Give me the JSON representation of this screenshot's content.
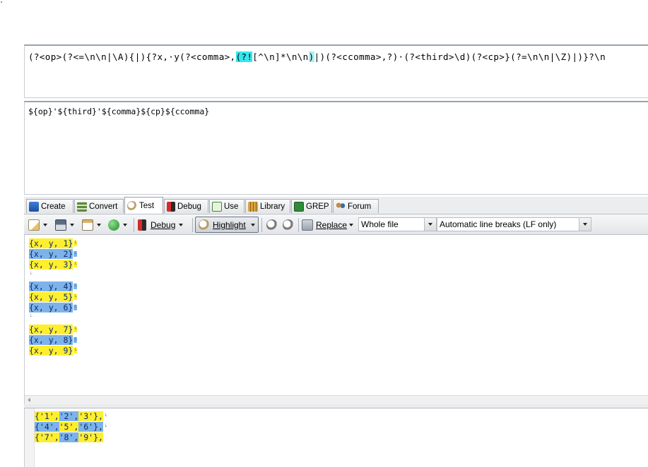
{
  "regex": {
    "seg1": "(?<op>(?<=\\n\\n|\\A){|){?x,·y(?<comma>,",
    "seg2": "(?!",
    "seg3": "[^\\n]*\\n\\n",
    "seg4": ")",
    "seg5": "|)(?<ccomma>,?)·(?<third>\\d)(?<cp>}(?=\\n\\n|\\Z)|)}?\\n"
  },
  "replacement": "${op}'${third}'${comma}${cp}${ccomma}",
  "tabs": [
    {
      "label": "Create",
      "icon": "create-icon"
    },
    {
      "label": "Convert",
      "icon": "convert-icon"
    },
    {
      "label": "Test",
      "icon": "magnifier-icon"
    },
    {
      "label": "Debug",
      "icon": "bug-icon"
    },
    {
      "label": "Use",
      "icon": "use-icon"
    },
    {
      "label": "Library",
      "icon": "library-icon"
    },
    {
      "label": "GREP",
      "icon": "grep-icon"
    },
    {
      "label": "Forum",
      "icon": "forum-icon"
    }
  ],
  "toolbar": {
    "debug_label": "Debug",
    "highlight_label": "Highlight",
    "replace_label": "Replace",
    "scope_value": "Whole file",
    "linebreak_value": "Automatic line breaks (LF only)"
  },
  "test_lines": [
    {
      "text": "{x, y, 1}",
      "color": "#ffee2e"
    },
    {
      "text": "{x, y, 2}",
      "color": "#7db3ea"
    },
    {
      "text": "{x, y, 3}",
      "color": "#ffee2e"
    },
    {
      "text": "",
      "color": ""
    },
    {
      "text": "{x, y, 4}",
      "color": "#7db3ea"
    },
    {
      "text": "{x, y, 5}",
      "color": "#ffee2e"
    },
    {
      "text": "{x, y, 6}",
      "color": "#7db3ea"
    },
    {
      "text": "",
      "color": ""
    },
    {
      "text": "{x, y, 7}",
      "color": "#ffee2e"
    },
    {
      "text": "{x, y, 8}",
      "color": "#7db3ea"
    },
    {
      "text": "{x, y, 9}",
      "color": "#ffee2e"
    }
  ],
  "output_lines": [
    [
      {
        "text": "{'1',",
        "color": "#ffee2e"
      },
      {
        "text": "'2',",
        "color": "#7db3ea"
      },
      {
        "text": "'3'},",
        "color": "#ffee2e"
      }
    ],
    [
      {
        "text": "{'4',",
        "color": "#7db3ea"
      },
      {
        "text": "'5',",
        "color": "#ffee2e"
      },
      {
        "text": "'6'},",
        "color": "#7db3ea"
      }
    ],
    [
      {
        "text": "{'7',",
        "color": "#ffee2e"
      },
      {
        "text": "'8',",
        "color": "#7db3ea"
      },
      {
        "text": "'9'},",
        "color": "#ffee2e"
      }
    ]
  ],
  "colors": {
    "match_yellow": "#ffee2e",
    "match_blue": "#7db3ea",
    "regex_highlight": "#36e6ee"
  }
}
